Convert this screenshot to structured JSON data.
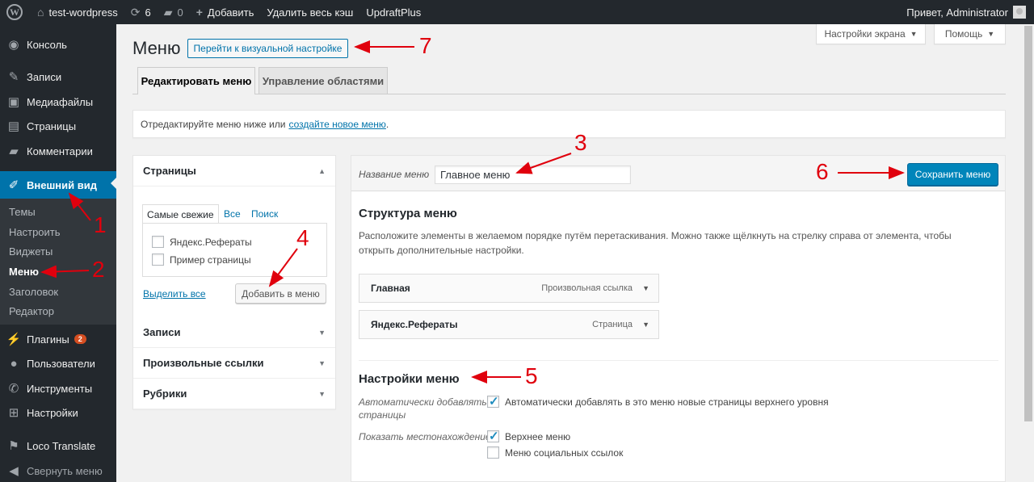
{
  "admin_bar": {
    "site_name": "test-wordpress",
    "updates_count": "6",
    "comments_count": "0",
    "add_label": "Добавить",
    "purge_cache_label": "Удалить весь кэш",
    "plugin_label": "UpdraftPlus",
    "greeting": "Привет, Administrator"
  },
  "sidebar": {
    "items": [
      {
        "label": "Консоль",
        "icon": "dashboard-icon"
      },
      {
        "label": "Записи",
        "icon": "pin-icon"
      },
      {
        "label": "Медиафайлы",
        "icon": "media-icon"
      },
      {
        "label": "Страницы",
        "icon": "pages-icon"
      },
      {
        "label": "Комментарии",
        "icon": "comments-icon"
      },
      {
        "label": "Внешний вид",
        "icon": "brush-icon"
      }
    ],
    "submenu": [
      "Темы",
      "Настроить",
      "Виджеты",
      "Меню",
      "Заголовок",
      "Редактор"
    ],
    "items_bottom": [
      {
        "label": "Плагины",
        "icon": "plugins-icon",
        "badge": "2"
      },
      {
        "label": "Пользователи",
        "icon": "users-icon"
      },
      {
        "label": "Инструменты",
        "icon": "tools-icon"
      },
      {
        "label": "Настройки",
        "icon": "settings-icon"
      },
      {
        "label": "Loco Translate",
        "icon": "translate-icon"
      }
    ],
    "collapse_label": "Свернуть меню"
  },
  "header": {
    "title": "Меню",
    "live_preview_button": "Перейти к визуальной настройке",
    "screen_options": "Настройки экрана",
    "help": "Помощь"
  },
  "tabs": [
    "Редактировать меню",
    "Управление областями"
  ],
  "notice": {
    "text": "Отредактируйте меню ниже или",
    "link": "создайте новое меню",
    "suffix": "."
  },
  "accordion": {
    "pages_title": "Страницы",
    "inner_tabs": [
      "Самые свежие",
      "Все",
      "Поиск"
    ],
    "pages": [
      "Яндекс.Рефераты",
      "Пример страницы"
    ],
    "select_all": "Выделить все",
    "add_to_menu": "Добавить в меню",
    "sections": [
      "Записи",
      "Произвольные ссылки",
      "Рубрики"
    ]
  },
  "editor": {
    "name_label": "Название меню",
    "name_value": "Главное меню",
    "save_button": "Сохранить меню",
    "structure_title": "Структура меню",
    "structure_desc": "Расположите элементы в желаемом порядке путём перетаскивания. Можно также щёлкнуть на стрелку справа от элемента, чтобы открыть дополнительные настройки.",
    "menu_items": [
      {
        "title": "Главная",
        "type": "Произвольная ссылка"
      },
      {
        "title": "Яндекс.Рефераты",
        "type": "Страница"
      }
    ],
    "settings_title": "Настройки меню",
    "auto_add_label": "Автоматически добавлять страницы",
    "auto_add_option": "Автоматически добавлять в это меню новые страницы верхнего уровня",
    "location_label": "Показать местонахождение",
    "locations": [
      {
        "label": "Верхнее меню",
        "checked": true
      },
      {
        "label": "Меню социальных ссылок",
        "checked": false
      }
    ]
  },
  "annotations": [
    "1",
    "2",
    "3",
    "4",
    "5",
    "6",
    "7"
  ],
  "colors": {
    "accent": "#0073aa",
    "primary_button": "#0085ba",
    "annotation": "#e0000d",
    "adminbar": "#23282d"
  }
}
